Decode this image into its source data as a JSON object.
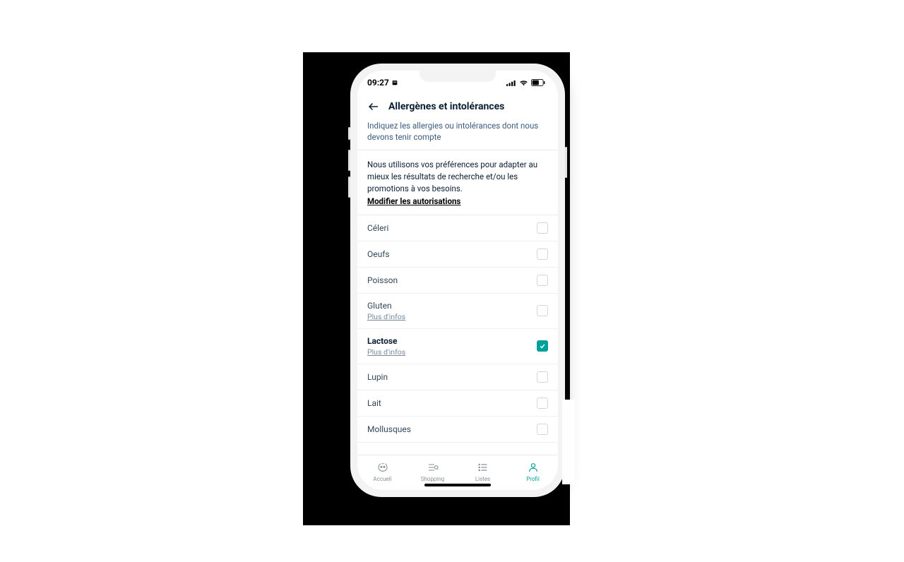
{
  "status": {
    "time": "09:27"
  },
  "header": {
    "title": "Allergènes et intolérances"
  },
  "subhead": "Indiquez les allergies ou intolérances dont nous devons tenir compte",
  "preferences": {
    "text": "Nous utilisons vos préférences pour adapter au mieux les résultats de recherche et/ou les promotions à vos besoins.",
    "link": "Modifier les autorisations"
  },
  "more_info_label": "Plus d'infos",
  "allergens": [
    {
      "label": "Céleri",
      "has_more": false,
      "checked": false
    },
    {
      "label": "Oeufs",
      "has_more": false,
      "checked": false
    },
    {
      "label": "Poisson",
      "has_more": false,
      "checked": false
    },
    {
      "label": "Gluten",
      "has_more": true,
      "checked": false
    },
    {
      "label": "Lactose",
      "has_more": true,
      "checked": true
    },
    {
      "label": "Lupin",
      "has_more": false,
      "checked": false
    },
    {
      "label": "Lait",
      "has_more": false,
      "checked": false
    },
    {
      "label": "Mollusques",
      "has_more": false,
      "checked": false
    }
  ],
  "tabs": [
    {
      "id": "accueil",
      "label": "Accueil",
      "active": false
    },
    {
      "id": "shopping",
      "label": "Shopping",
      "active": false
    },
    {
      "id": "listes",
      "label": "Listes",
      "active": false
    },
    {
      "id": "profil",
      "label": "Profil",
      "active": true
    }
  ],
  "colors": {
    "accent": "#00a19a"
  }
}
